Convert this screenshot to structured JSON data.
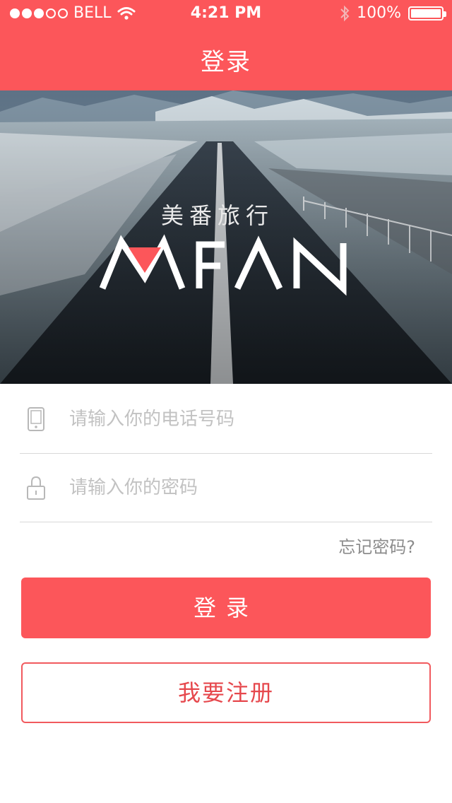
{
  "status_bar": {
    "carrier": "BELL",
    "time": "4:21 PM",
    "battery": "100%",
    "signal_bars_filled": 3,
    "signal_bars_total": 5
  },
  "header": {
    "title": "登录"
  },
  "hero": {
    "brand_subtitle": "美番旅行",
    "brand_logo": "MFAN"
  },
  "form": {
    "phone_placeholder": "请输入你的电话号码",
    "password_placeholder": "请输入你的密码",
    "phone_value": "",
    "password_value": "",
    "forgot_label": "忘记密码?"
  },
  "buttons": {
    "login_label": "登录",
    "register_label": "我要注册"
  },
  "colors": {
    "accent": "#fc565a",
    "register_text": "#e6484d",
    "placeholder": "#c2c2c2"
  },
  "icons": {
    "phone": "phone-icon",
    "lock": "lock-icon",
    "wifi": "wifi-icon",
    "bluetooth": "bluetooth-icon",
    "battery": "battery-icon"
  }
}
